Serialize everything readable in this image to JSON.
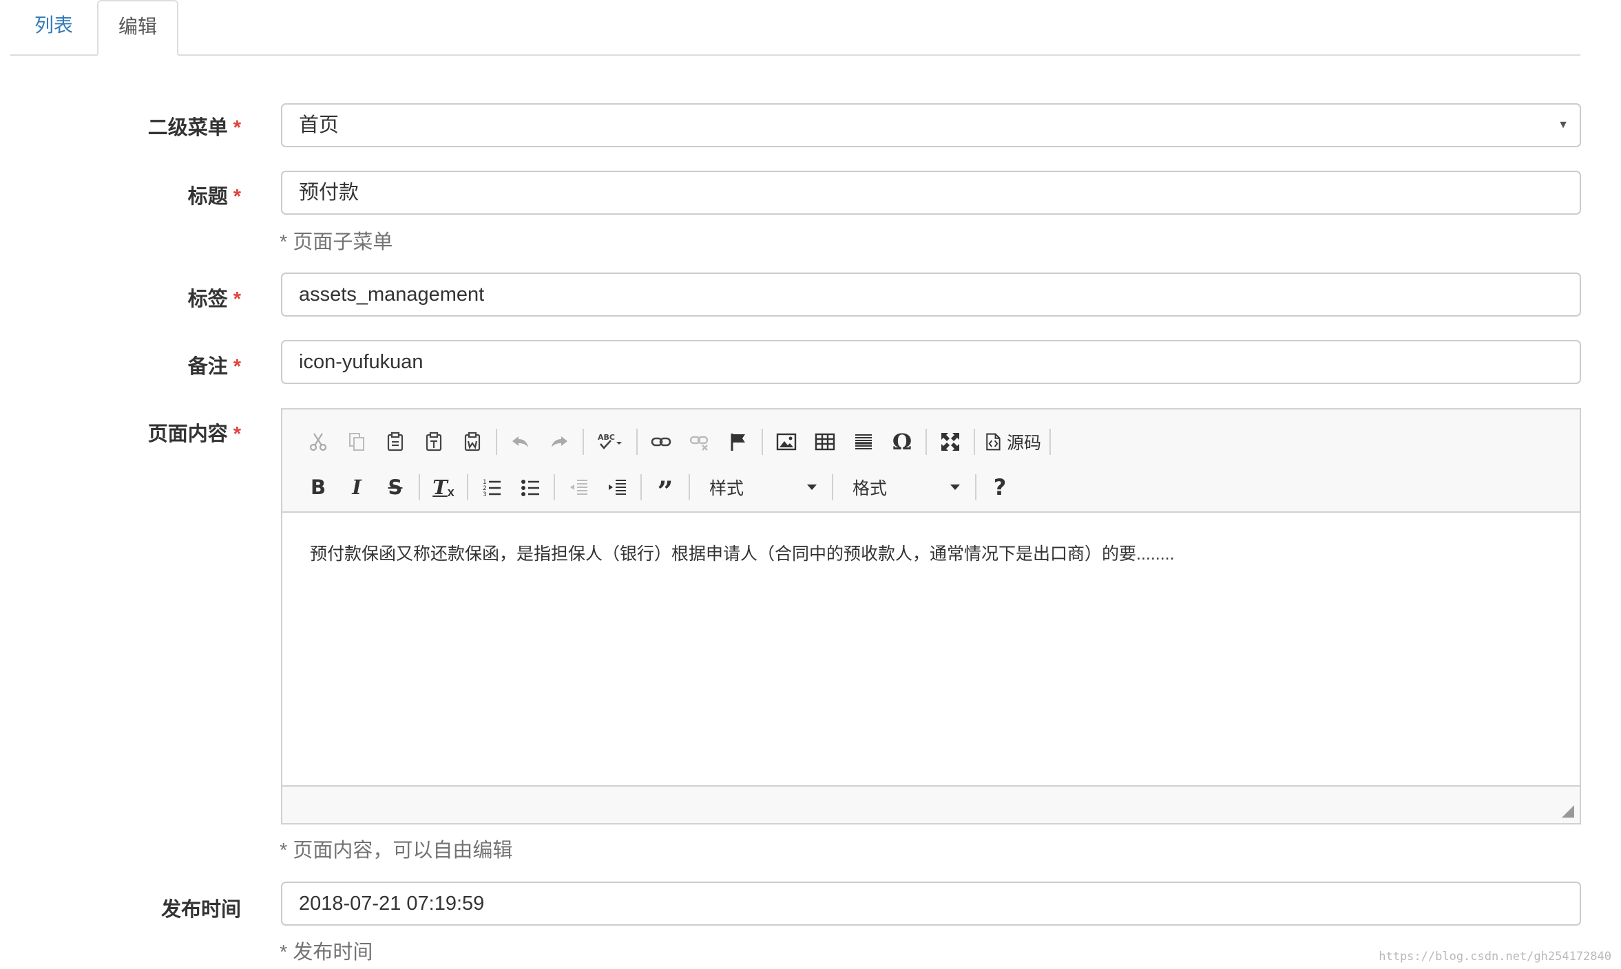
{
  "tabs": [
    {
      "label": "列表"
    },
    {
      "label": "编辑"
    }
  ],
  "form": {
    "menu": {
      "label": "二级菜单",
      "required": "*",
      "value": "首页"
    },
    "title": {
      "label": "标题",
      "required": "*",
      "value": "预付款",
      "help": "* 页面子菜单"
    },
    "tag": {
      "label": "标签",
      "required": "*",
      "value": "assets_management"
    },
    "note": {
      "label": "备注",
      "required": "*",
      "value": "icon-yufukuan"
    },
    "content": {
      "label": "页面内容",
      "required": "*",
      "text": "预付款保函又称还款保函，是指担保人（银行）根据申请人（合同中的预收款人，通常情况下是出口商）的要........",
      "help": "* 页面内容，可以自由编辑",
      "toolbar": {
        "source_label": "源码",
        "styles_label": "样式",
        "format_label": "格式"
      }
    },
    "publish": {
      "label": "发布时间",
      "value": "2018-07-21 07:19:59",
      "help": "* 发布时间"
    }
  },
  "watermark": "https://blog.csdn.net/gh254172840",
  "colors": {
    "link": "#337ab7",
    "required": "#e0443c",
    "border": "#cccccc"
  }
}
